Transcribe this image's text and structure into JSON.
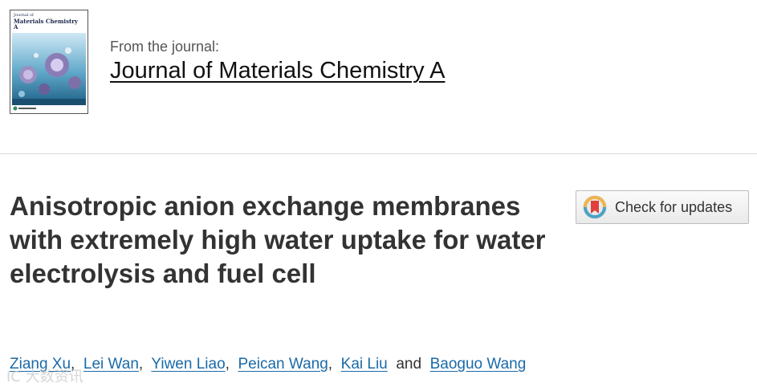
{
  "journal": {
    "from_label": "From the journal:",
    "name": "Journal of Materials Chemistry A",
    "cover_line1": "Journal of",
    "cover_line2": "Materials Chemistry A"
  },
  "article": {
    "title": "Anisotropic anion exchange membranes with extremely high water uptake for water electrolysis and fuel cell"
  },
  "updates_button": {
    "label": "Check for updates",
    "icon": "crossmark-icon"
  },
  "authors": {
    "list": [
      "Ziang Xu",
      "Lei Wan",
      "Yiwen Liao",
      "Peican Wang",
      "Kai Liu",
      "Baoguo Wang"
    ],
    "comma": ",",
    "conjunction": "and"
  },
  "watermark": {
    "text": "IC 大数资讯"
  },
  "colors": {
    "link": "#1a6aa8",
    "text": "#333333",
    "divider": "#d9d9d9",
    "cover_navy": "#1b2a4e"
  }
}
